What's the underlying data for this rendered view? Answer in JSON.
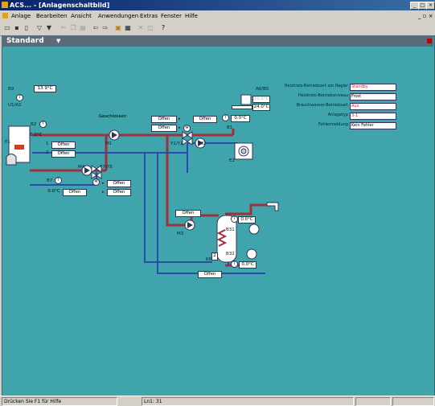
{
  "window": {
    "title": "ACS... - [Anlagenschaltbild]",
    "min": "_",
    "max": "□",
    "close": "×"
  },
  "menu": [
    "Anlage",
    "Bearbeiten",
    "Ansicht",
    "Anwendungen",
    "Extras",
    "Fenster",
    "Hilfe"
  ],
  "toolbar": {
    "icons": [
      "open-icon",
      "save-icon",
      "print-preview-icon",
      "filter-icon",
      "filter-active-icon",
      "cut-icon",
      "copy-icon",
      "paste-icon",
      "back-icon",
      "forward-icon",
      "folder-icon",
      "grid-icon",
      "delete-icon",
      "properties-icon",
      "help-icon"
    ]
  },
  "view": {
    "selected": "Standard"
  },
  "plant": {
    "b9_label": "B9",
    "b9_value": "13.9°C",
    "u1a2": "U1/A2",
    "a6b5_label": "A6/B5",
    "a6b5_value1": "10.0°C",
    "a6b5_value2": "24.0°C",
    "e1": "E1",
    "b2": "B2",
    "b2_temp": "0.0°C",
    "s1": "1",
    "s2": "2",
    "e1_offen1": "Offen",
    "e1_offen2": "Offen",
    "m1": "M1",
    "m1_state": "Geschlossen",
    "y1y2": "Y1/Y2",
    "y1y2_offen1": "Offen",
    "y1y2_offen2": "Offen",
    "m2": "M2",
    "m2_offen": "Offen",
    "b1": "B1",
    "b1_temp": "0.0°C",
    "e2": "E2",
    "m4": "M4",
    "y7y8": "Y7/Y8",
    "y7y8_offen1": "Offen",
    "y7y8_offen2": "Offen",
    "b7": "B7",
    "b7_temp": "0.0°C",
    "b7_offen": "Offen",
    "m3": "M3",
    "m3_offen": "Offen",
    "b31": "B31",
    "b31_temp": "0.0°C",
    "k6": "K6",
    "b32": "B32",
    "b32_temp": "0.0°C",
    "b32_offen": "Offen"
  },
  "info": [
    {
      "label": "Heizkreis-Betriebsart am Regler",
      "value": "Standby",
      "color": "#e02020"
    },
    {
      "label": "Heizkreis-Betriebsniveau",
      "value": "Frost",
      "color": "#000000"
    },
    {
      "label": "Brauchwasser-Betriebsart",
      "value": "Aus",
      "color": "#e02020"
    },
    {
      "label": "Anlagetyp",
      "value": "3-1",
      "color": "#e02020"
    },
    {
      "label": "Fehlermeldung",
      "value": "Kein Fehler",
      "color": "#000000"
    }
  ],
  "colors": {
    "supply": "#a0303a",
    "return": "#2c4aa8",
    "background": "#3fa4ac"
  },
  "status": {
    "help": "Drücken Sie F1 für Hilfe",
    "position": "Ln1: 31"
  }
}
